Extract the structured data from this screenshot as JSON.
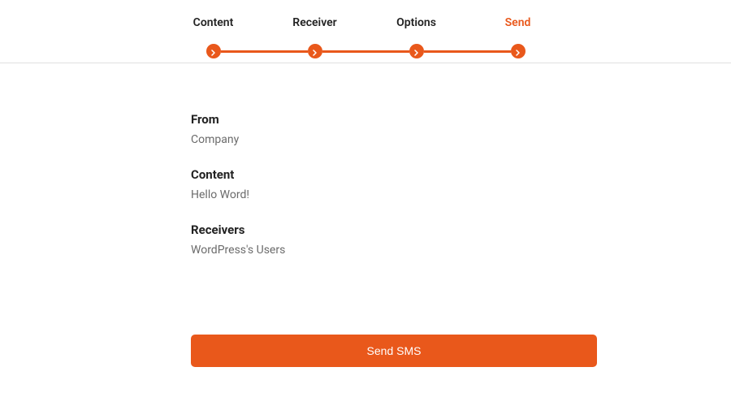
{
  "steps": {
    "items": [
      {
        "label": "Content"
      },
      {
        "label": "Receiver"
      },
      {
        "label": "Options"
      },
      {
        "label": "Send"
      }
    ],
    "active_index": 3
  },
  "summary": {
    "from_label": "From",
    "from_value": "Company",
    "content_label": "Content",
    "content_value": "Hello Word!",
    "receivers_label": "Receivers",
    "receivers_value": "WordPress's Users"
  },
  "actions": {
    "send_label": "Send SMS"
  },
  "colors": {
    "accent": "#e9581b"
  }
}
